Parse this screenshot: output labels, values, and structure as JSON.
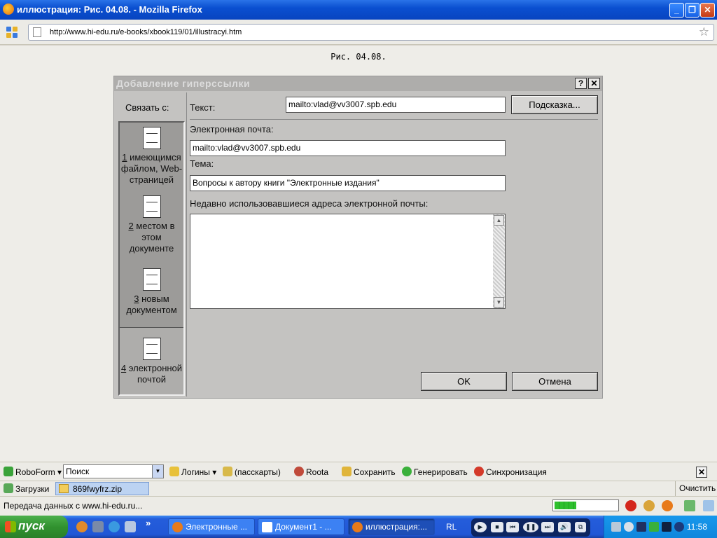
{
  "window": {
    "title": "иллюстрация: Рис. 04.08. - Mozilla Firefox",
    "min": "_",
    "restore": "❐",
    "close": "✕"
  },
  "nav": {
    "url": "http://www.hi-edu.ru/e-books/xbook119/01/illustracyi.htm",
    "star": "☆"
  },
  "page": {
    "caption": "Рис. 04.08."
  },
  "dialog": {
    "title": "Добавление гиперссылки",
    "help_btn": "?",
    "close_btn": "✕",
    "link_to_label": "Связать с:",
    "places": [
      {
        "hotkey": "1",
        "label": " имеющимся файлом, Web-страницей"
      },
      {
        "hotkey": "2",
        "label": " местом в этом документе"
      },
      {
        "hotkey": "3",
        "label": " новым документом"
      },
      {
        "hotkey": "4",
        "label": " электронной почтой"
      }
    ],
    "text_label": "Текст:",
    "text_value": "mailto:vlad@vv3007.spb.edu",
    "hint_button": "Подсказка...",
    "email_label": "Электронная почта:",
    "email_value": "mailto:vlad@vv3007.spb.edu",
    "subject_label": "Тема:",
    "subject_value": "Вопросы к автору книги \"Электронные издания\"",
    "recent_label": "Недавно использовавшиеся адреса электронной почты:",
    "ok_button": "OK",
    "cancel_button": "Отмена"
  },
  "roboform": {
    "brand": "RoboForm",
    "search_placeholder": "Поиск",
    "logins": "Логины",
    "passcards": "(пасскарты)",
    "roota": "Roota",
    "save": "Сохранить",
    "generate": "Генерировать",
    "sync": "Синхронизация"
  },
  "downloads": {
    "label": "Загрузки",
    "file": "869fwyfrz.zip",
    "clear": "Очистить"
  },
  "status": {
    "text": "Передача данных с www.hi-edu.ru...",
    "progress": 0.33
  },
  "taskbar": {
    "start": "пуск",
    "more": "»",
    "tasks": [
      {
        "label": "Электронные ..."
      },
      {
        "label": "Документ1 - ..."
      },
      {
        "label": "иллюстрация:..."
      }
    ],
    "lang": "RL",
    "clock": "11:58"
  },
  "colors": {
    "titlebar": "#0a4fd0",
    "dialog_bg": "#c4c3c1",
    "taskbar": "#245ddb",
    "start": "#31922f"
  }
}
